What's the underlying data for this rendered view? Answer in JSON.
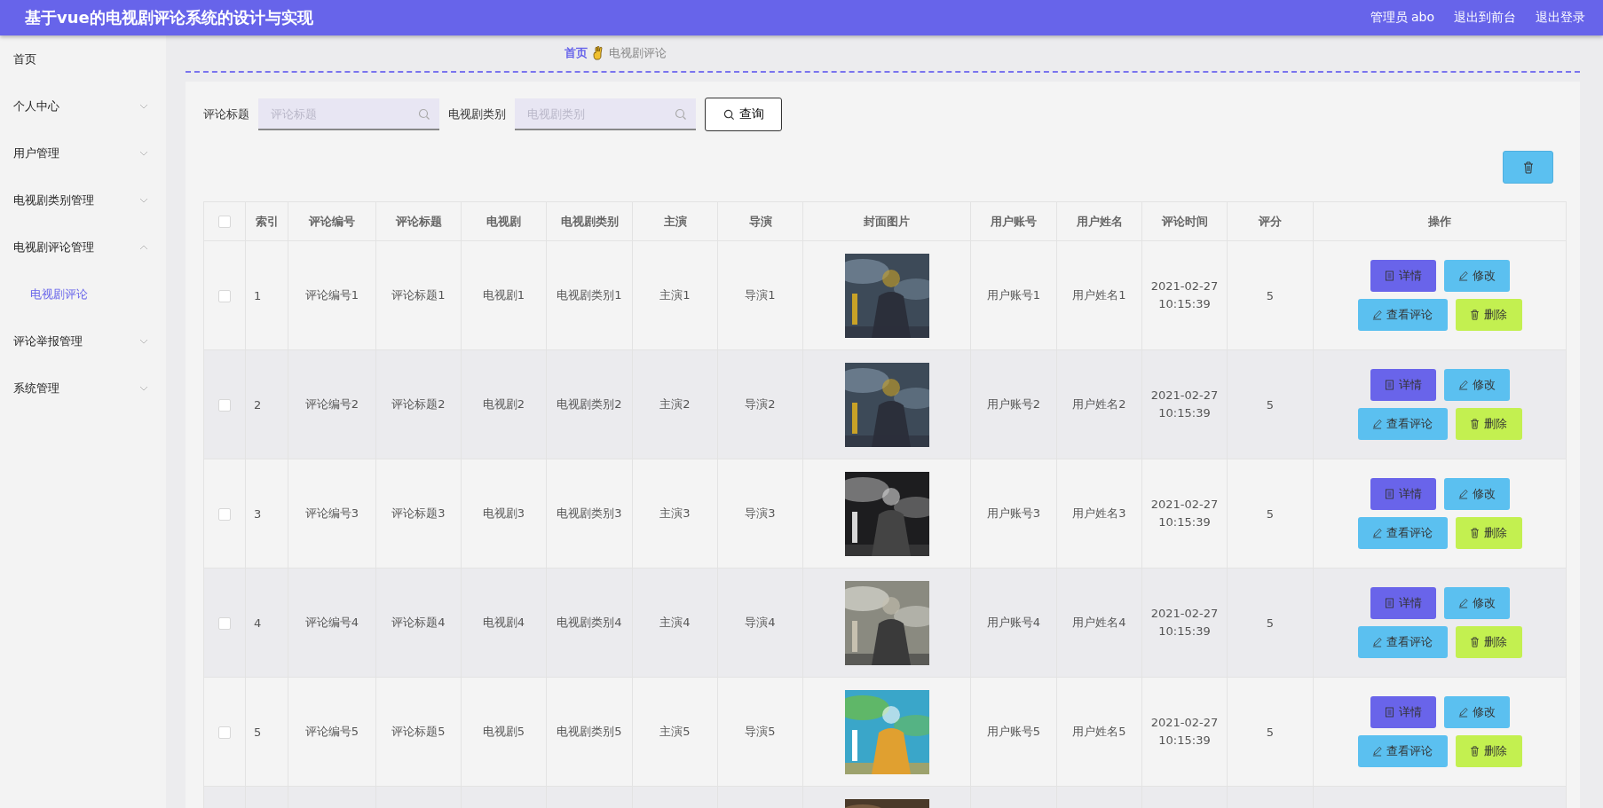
{
  "header": {
    "title": "基于vue的电视剧评论系统的设计与实现",
    "links": [
      "管理员 abo",
      "退出到前台",
      "退出登录"
    ]
  },
  "sidebar": {
    "items": [
      {
        "label": "首页",
        "kind": "link"
      },
      {
        "label": "个人中心",
        "kind": "menu",
        "expanded": false
      },
      {
        "label": "用户管理",
        "kind": "menu",
        "expanded": false
      },
      {
        "label": "电视剧类别管理",
        "kind": "menu",
        "expanded": false
      },
      {
        "label": "电视剧评论管理",
        "kind": "menu",
        "expanded": true,
        "children": [
          {
            "label": "电视剧评论",
            "selected": true
          }
        ]
      },
      {
        "label": "评论举报管理",
        "kind": "menu",
        "expanded": false
      },
      {
        "label": "系统管理",
        "kind": "menu",
        "expanded": false
      }
    ]
  },
  "breadcrumb": [
    "首页",
    "电视剧评论"
  ],
  "search": {
    "fields": [
      {
        "label": "评论标题",
        "placeholder": "评论标题"
      },
      {
        "label": "电视剧类别",
        "placeholder": "电视剧类别"
      }
    ],
    "button": "查询"
  },
  "table": {
    "select_all_checked": false,
    "columns": [
      "索引",
      "评论编号",
      "评论标题",
      "电视剧",
      "电视剧类别",
      "主演",
      "导演",
      "封面图片",
      "用户账号",
      "用户姓名",
      "评论时间",
      "评分",
      "操作"
    ],
    "rows": [
      {
        "checked": false,
        "index": "1",
        "code": "评论编号1",
        "title": "评论标题1",
        "drama": "电视剧1",
        "category": "电视剧类别1",
        "actor": "主演1",
        "director": "导演1",
        "cover": {
          "kind": "picture"
        },
        "account": "用户账号1",
        "name": "用户姓名1",
        "time": "2021-02-27 10:15:39",
        "score": "5",
        "actions": [
          "详情",
          "修改",
          "查看评论",
          "删除"
        ]
      },
      {
        "checked": false,
        "index": "2",
        "code": "评论编号2",
        "title": "评论标题2",
        "drama": "电视剧2",
        "category": "电视剧类别2",
        "actor": "主演2",
        "director": "导演2",
        "cover": {
          "kind": "picture"
        },
        "account": "用户账号2",
        "name": "用户姓名2",
        "time": "2021-02-27 10:15:39",
        "score": "5",
        "actions": [
          "详情",
          "修改",
          "查看评论",
          "删除"
        ]
      },
      {
        "checked": false,
        "index": "3",
        "code": "评论编号3",
        "title": "评论标题3",
        "drama": "电视剧3",
        "category": "电视剧类别3",
        "actor": "主演3",
        "director": "导演3",
        "cover": {
          "kind": "picture"
        },
        "account": "用户账号3",
        "name": "用户姓名3",
        "time": "2021-02-27 10:15:39",
        "score": "5",
        "actions": [
          "详情",
          "修改",
          "查看评论",
          "删除"
        ]
      },
      {
        "checked": false,
        "index": "4",
        "code": "评论编号4",
        "title": "评论标题4",
        "drama": "电视剧4",
        "category": "电视剧类别4",
        "actor": "主演4",
        "director": "导演4",
        "cover": {
          "kind": "picture"
        },
        "account": "用户账号4",
        "name": "用户姓名4",
        "time": "2021-02-27 10:15:39",
        "score": "5",
        "actions": [
          "详情",
          "修改",
          "查看评论",
          "删除"
        ]
      },
      {
        "checked": false,
        "index": "5",
        "code": "评论编号5",
        "title": "评论标题5",
        "drama": "电视剧5",
        "category": "电视剧类别5",
        "actor": "主演5",
        "director": "导演5",
        "cover": {
          "kind": "picture"
        },
        "account": "用户账号5",
        "name": "用户姓名5",
        "time": "2021-02-27 10:15:39",
        "score": "5",
        "actions": [
          "详情",
          "修改",
          "查看评论",
          "删除"
        ]
      },
      {
        "cover": {
          "kind": "picture"
        }
      }
    ]
  }
}
